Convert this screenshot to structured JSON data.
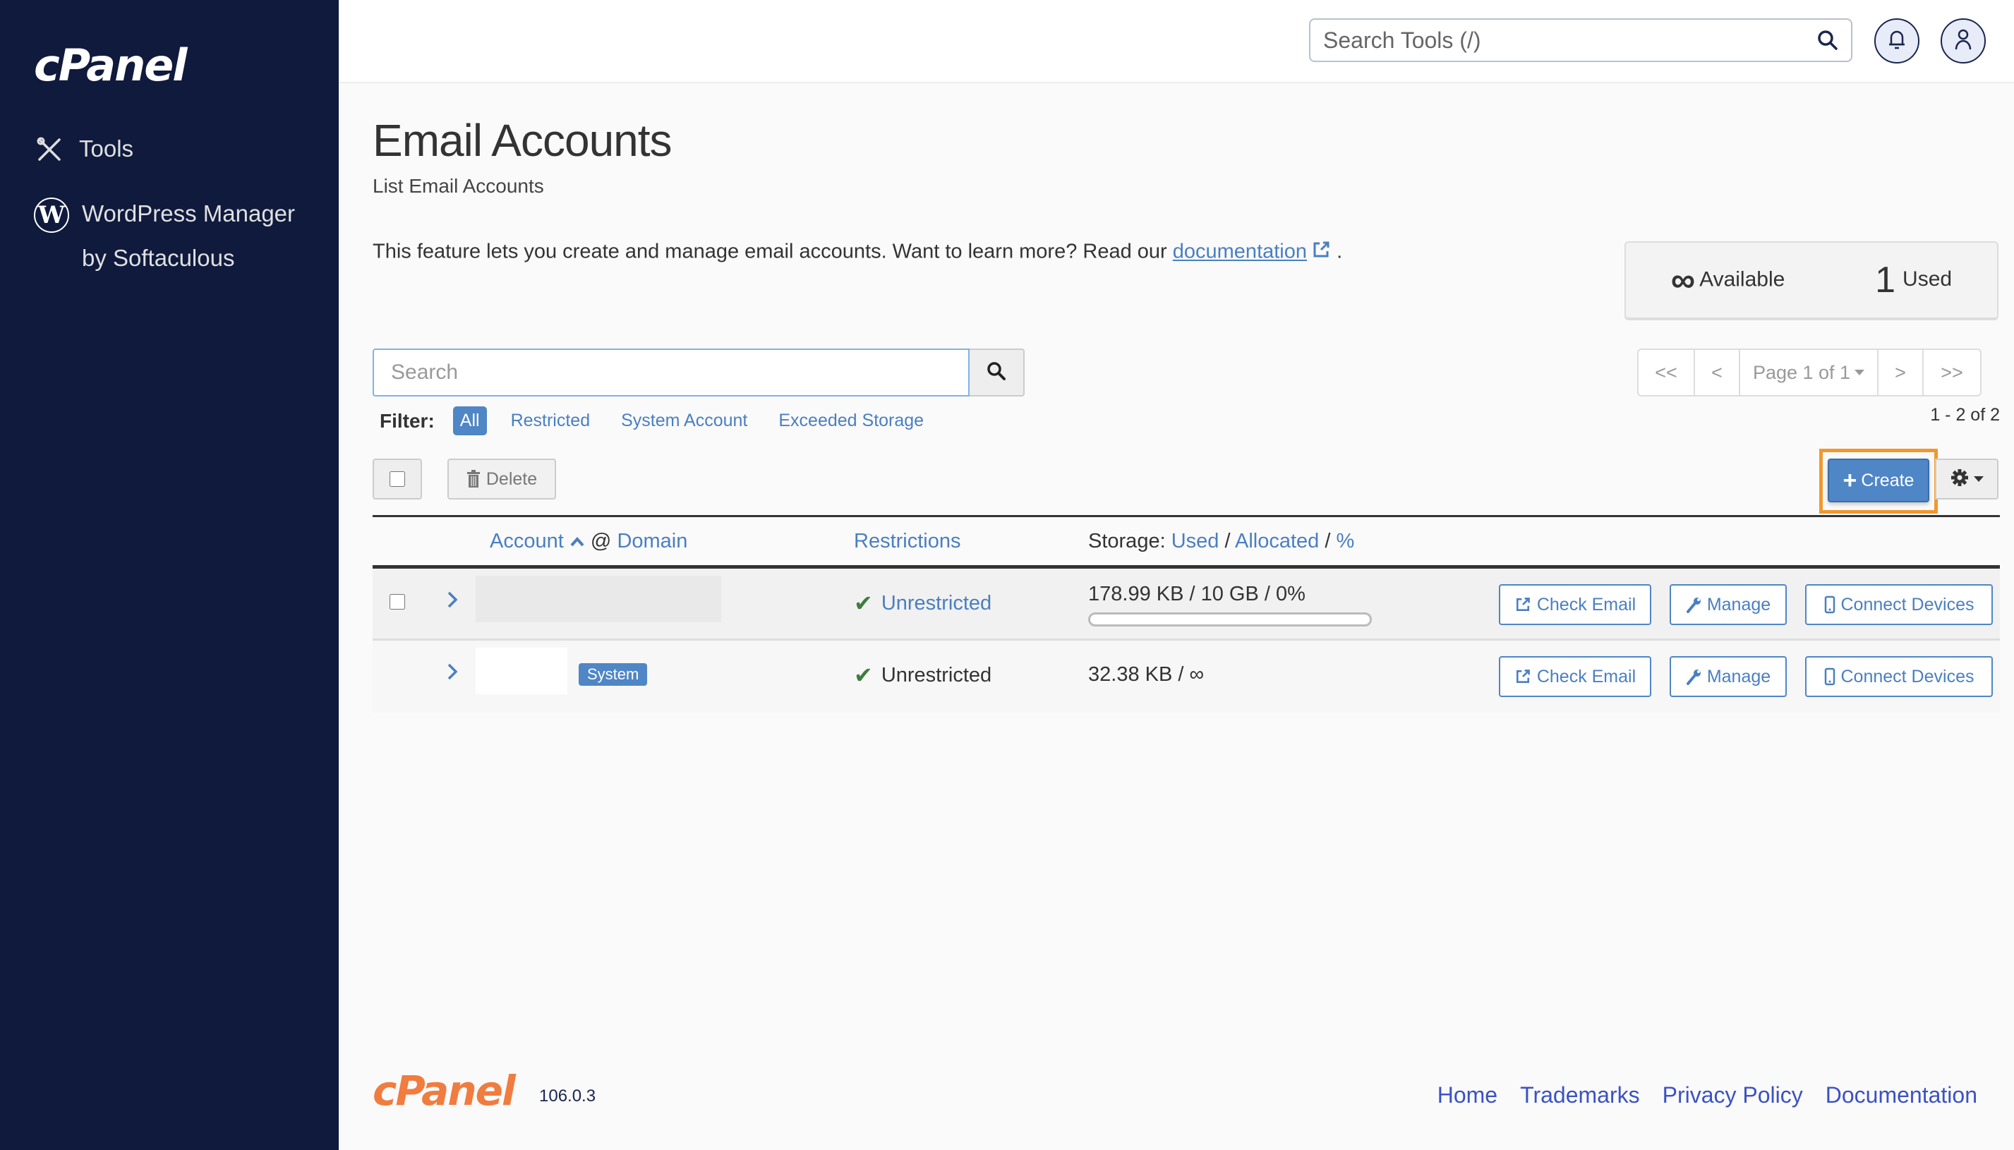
{
  "sidebar": {
    "logo": "cPanel",
    "items": [
      {
        "label": "Tools",
        "icon": "tools-icon"
      },
      {
        "label": "WordPress Manager by Softaculous",
        "icon": "wordpress-icon"
      }
    ]
  },
  "topbar": {
    "search_placeholder": "Search Tools (/)",
    "icons": [
      "search-icon",
      "bell-icon",
      "user-icon"
    ]
  },
  "page": {
    "title": "Email Accounts",
    "subtitle": "List Email Accounts",
    "description": "This feature lets you create and manage email accounts. Want to learn more? Read our",
    "doc_link": "documentation",
    "desc_end": "."
  },
  "stats": {
    "available_value": "∞",
    "available_label": "Available",
    "used_value": "1",
    "used_label": "Used"
  },
  "search": {
    "placeholder": "Search"
  },
  "filter": {
    "label": "Filter:",
    "options": [
      "All",
      "Restricted",
      "System Account",
      "Exceeded Storage"
    ],
    "active": "All"
  },
  "pagination": {
    "first": "<<",
    "prev": "<",
    "page_label": "Page 1 of 1",
    "next": ">",
    "last": ">>",
    "range": "1 - 2 of 2"
  },
  "toolbar": {
    "delete_label": "Delete",
    "create_label": "Create",
    "create_highlight_color": "#f0982f"
  },
  "table": {
    "headers": {
      "account": "Account",
      "at": "@",
      "domain": "Domain",
      "restrictions": "Restrictions",
      "storage_prefix": "Storage:",
      "used": "Used",
      "allocated": "Allocated",
      "percent": "%",
      "sep": "/"
    },
    "rows": [
      {
        "account": "",
        "badge": "",
        "restriction": "Unrestricted",
        "storage": "178.99 KB / 10 GB / 0%",
        "usage_percent": 0,
        "actions": [
          "Check Email",
          "Manage",
          "Connect Devices"
        ]
      },
      {
        "account": "",
        "badge": "System",
        "restriction": "Unrestricted",
        "storage": "32.38 KB / ∞",
        "actions": [
          "Check Email",
          "Manage",
          "Connect Devices"
        ]
      }
    ]
  },
  "footer": {
    "logo": "cPanel",
    "version": "106.0.3",
    "links": [
      "Home",
      "Trademarks",
      "Privacy Policy",
      "Documentation"
    ]
  },
  "colors": {
    "sidebar_bg": "#0f1a3d",
    "link": "#4a7fc1",
    "primary": "#4f86c6",
    "success": "#3f7c3f",
    "footer_logo": "#f07c3f"
  }
}
